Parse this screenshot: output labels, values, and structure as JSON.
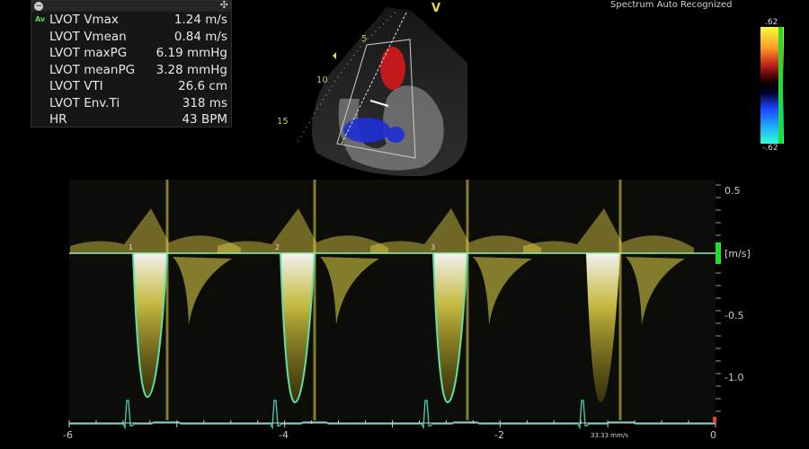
{
  "measurements": [
    {
      "label": "LVOT Vmax",
      "value": "1.24 m/s"
    },
    {
      "label": "LVOT Vmean",
      "value": "0.84 m/s"
    },
    {
      "label": "LVOT maxPG",
      "value": "6.19 mmHg"
    },
    {
      "label": "LVOT meanPG",
      "value": "3.28 mmHg"
    },
    {
      "label": "LVOT VTI",
      "value": "26.6 cm"
    },
    {
      "label": "LVOT Env.Ti",
      "value": "318 ms"
    },
    {
      "label": "HR",
      "value": "43 BPM"
    }
  ],
  "measurement_tag": "Av",
  "status_text": "Spectrum Auto Recognized",
  "color_scale": {
    "top_label": ".62",
    "bottom_label": "-.62"
  },
  "image_marker": "V",
  "depth_labels": [
    "5",
    "10",
    "15"
  ],
  "doppler": {
    "unit": "[m/s]",
    "y_ticks": [
      "0.5",
      "-0.5",
      "-1.0"
    ],
    "x_ticks": [
      "-6",
      "-4",
      "-2",
      "0"
    ],
    "sweep_speed": "33.33 mm/s",
    "beat_labels": [
      "1",
      "2",
      "3"
    ],
    "envelope_color": "#5ee0a6",
    "spectrum_color": "#e6d84a"
  }
}
